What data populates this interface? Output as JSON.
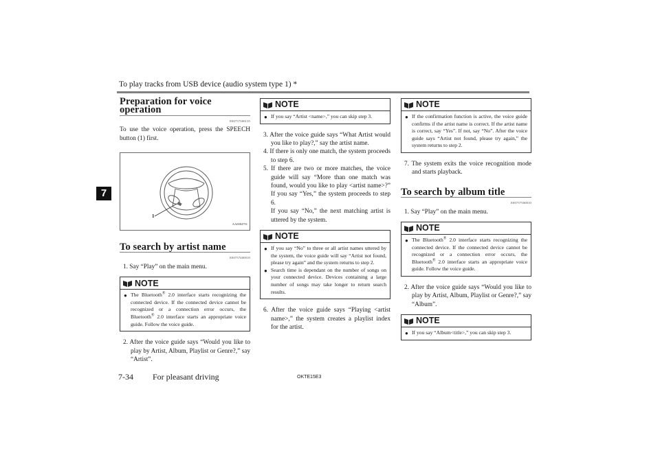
{
  "header": {
    "running_title": "To play tracks from USB device (audio system type 1) *",
    "chapter_tab": "7"
  },
  "col1": {
    "section1": {
      "title": "Preparation for voice operation",
      "code": "E00757300135",
      "text": "To use the voice operation, press the SPEECH button (1) first."
    },
    "figure": {
      "callout": "1",
      "code": "AA0084791",
      "icon": "steering-wheel-illustration"
    },
    "section2": {
      "title": "To search by artist name",
      "code": "E00757400019",
      "step1": "1. Say “Play” on the main menu.",
      "note": {
        "label": "NOTE",
        "item_pre": "The Bluetooth",
        "item_sup": "®",
        "item_mid": " 2.0 interface starts recognizing the connected device. If the connected device cannot be recognized or a connection error occurs, the Bluetooth",
        "item_sup2": "®",
        "item_post": " 2.0 interface starts an appropriate voice guide. Follow the voice guide."
      },
      "step2": "2. After the voice guide says “Would you like to play by Artist, Album, Playlist or Genre?,” say “Artist”."
    }
  },
  "col2": {
    "note1": {
      "label": "NOTE",
      "item": "If you say “Artist <name>,” you can skip step 3."
    },
    "step3": "3. After the voice guide says “What Artist would you like to play?,” say the artist name.",
    "step4": "4. If there is only one match, the system proceeds to step 6.",
    "step5": "5. If there are two or more matches, the voice guide will say “More than one match was found, would you like to play <artist name>?” If you say “Yes,” the system proceeds to step 6.",
    "step5b": "If you say “No,” the next matching artist is uttered by the system.",
    "note2": {
      "label": "NOTE",
      "items": [
        "If you say “No” to three or all artist names uttered by the system, the voice guide will say “Artist not found, please try again” and the system returns to step 2.",
        "Search time is dependant on the number of songs on your connected device. Devices containing a large number of songs may take longer to return search results."
      ]
    },
    "step6": "6. After the voice guide says “Playing <artist name>,” the system creates a playlist index for the artist."
  },
  "col3": {
    "note1": {
      "label": "NOTE",
      "item": "If the confirmation function is active, the voice guide confirms if the artist name is correct. If the artist name is correct, say “Yes”. If not, say “No”. After the voice guide says “Artist not found, please try again,” the system returns to step 2."
    },
    "step7": "7. The system exits the voice recognition mode and starts playback.",
    "section": {
      "title": "To search by album title",
      "code": "E00757500010",
      "step1": "1. Say “Play” on the main menu.",
      "note": {
        "label": "NOTE",
        "item_pre": "The Bluetooth",
        "item_sup": "®",
        "item_mid": " 2.0 interface starts recognizing the connected device. If the connected device cannot be recognized or a connection error occurs, the Bluetooth",
        "item_sup2": "®",
        "item_post": " 2.0 interface starts an appropriate voice guide. Follow the voice guide."
      },
      "step2": "2. After the voice guide says “Would you like to play by Artist, Album, Playlist or Genre?,” say “Album”.",
      "note2": {
        "label": "NOTE",
        "item": "If you say “Album<title>,” you can skip step 3."
      }
    }
  },
  "footer": {
    "page_number": "7-34",
    "section_title": "For pleasant driving",
    "doc_code": "OKTE15E3"
  }
}
